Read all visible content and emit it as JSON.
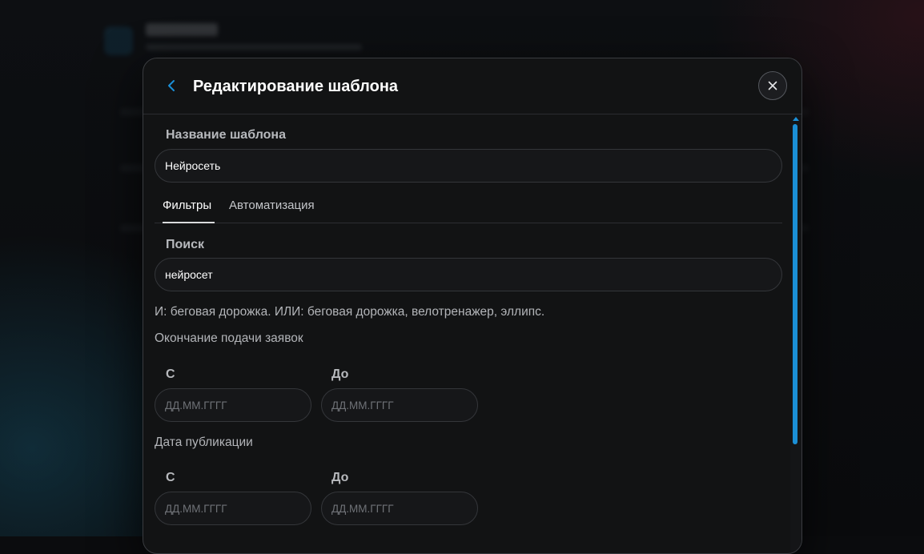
{
  "modal": {
    "title": "Редактирование шаблона",
    "template_name": {
      "label": "Название шаблона",
      "value": "Нейросеть"
    },
    "tabs": [
      {
        "label": "Фильтры",
        "active": true
      },
      {
        "label": "Автоматизация",
        "active": false
      }
    ],
    "search": {
      "label": "Поиск",
      "value": "нейросет",
      "hint": "И: беговая дорожка. ИЛИ: беговая дорожка, велотренажер, эллипс."
    },
    "deadline": {
      "title": "Окончание подачи заявок",
      "from_label": "С",
      "to_label": "До",
      "from_placeholder": "ДД.ММ.ГГГГ",
      "to_placeholder": "ДД.ММ.ГГГГ"
    },
    "published": {
      "title": "Дата публикации",
      "from_label": "С",
      "to_label": "До",
      "from_placeholder": "ДД.ММ.ГГГГ",
      "to_placeholder": "ДД.ММ.ГГГГ"
    }
  },
  "icons": {
    "back": "chevron-left-icon",
    "close": "close-icon"
  },
  "colors": {
    "accent": "#1b8fd6",
    "modal_bg": "#121314",
    "input_border": "#34363a"
  }
}
